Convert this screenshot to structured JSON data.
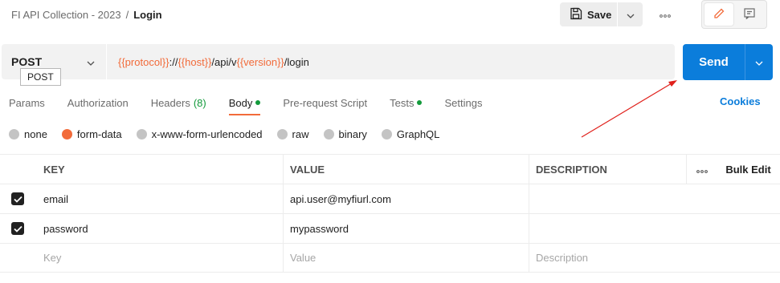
{
  "header": {
    "collection": "FI API Collection - 2023",
    "separator": "/",
    "request_name": "Login",
    "save_label": "Save"
  },
  "request": {
    "method": "POST",
    "method_tooltip": "POST",
    "url_parts": [
      {
        "text": "{{protocol}}",
        "var": true
      },
      {
        "text": "://",
        "var": false
      },
      {
        "text": "{{host}}",
        "var": true
      },
      {
        "text": "/api/v",
        "var": false
      },
      {
        "text": "{{version}}",
        "var": true
      },
      {
        "text": "/login",
        "var": false
      }
    ],
    "send_label": "Send"
  },
  "tabs": [
    {
      "label": "Params",
      "count": "",
      "dot": false,
      "active": false
    },
    {
      "label": "Authorization",
      "count": "",
      "dot": false,
      "active": false
    },
    {
      "label": "Headers",
      "count": "(8)",
      "dot": false,
      "active": false
    },
    {
      "label": "Body",
      "count": "",
      "dot": true,
      "active": true
    },
    {
      "label": "Pre-request Script",
      "count": "",
      "dot": false,
      "active": false
    },
    {
      "label": "Tests",
      "count": "",
      "dot": true,
      "active": false
    },
    {
      "label": "Settings",
      "count": "",
      "dot": false,
      "active": false
    }
  ],
  "cookies_label": "Cookies",
  "body_types": [
    {
      "label": "none",
      "selected": false
    },
    {
      "label": "form-data",
      "selected": true
    },
    {
      "label": "x-www-form-urlencoded",
      "selected": false
    },
    {
      "label": "raw",
      "selected": false
    },
    {
      "label": "binary",
      "selected": false
    },
    {
      "label": "GraphQL",
      "selected": false
    }
  ],
  "table": {
    "headers": {
      "key": "KEY",
      "value": "VALUE",
      "description": "DESCRIPTION",
      "bulk_edit": "Bulk Edit"
    },
    "rows": [
      {
        "checked": true,
        "key": "email",
        "value": "api.user@myfiurl.com",
        "description": ""
      },
      {
        "checked": true,
        "key": "password",
        "value": "mypassword",
        "description": ""
      }
    ],
    "placeholders": {
      "key": "Key",
      "value": "Value",
      "description": "Description"
    }
  },
  "colors": {
    "accent": "#f26b3a",
    "primary": "#0b7ddb",
    "success": "#139a3b",
    "annotation": "#e0201b"
  },
  "icons": {
    "save": "save-icon",
    "more": "more-horizontal-icon",
    "edit": "pencil-icon",
    "docs": "comment-icon",
    "chevron": "chevron-down-icon",
    "check": "check-icon"
  }
}
